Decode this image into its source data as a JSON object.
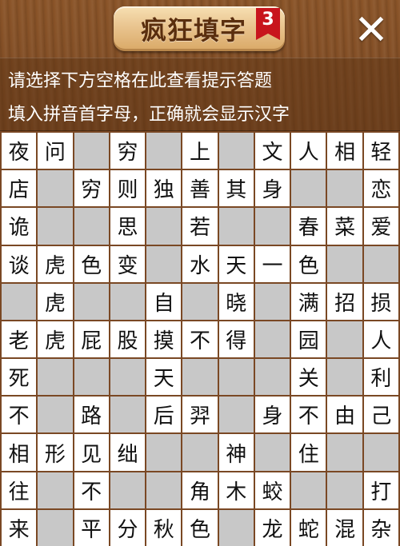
{
  "header": {
    "title": "疯狂填字",
    "level": "3",
    "close_label": "✕"
  },
  "hint": {
    "line1": "请选择下方空格在此查看提示答题",
    "line2": "填入拼音首字母，正确就会显示汉字"
  },
  "grid": {
    "cols": 11,
    "rows": [
      [
        "夜",
        "问",
        "#",
        "穷",
        "#",
        "上",
        "#",
        "文",
        "人",
        "相",
        "轻"
      ],
      [
        "店",
        "#",
        "穷",
        "则",
        "独",
        "善",
        "其",
        "身",
        "#",
        "#",
        "恋"
      ],
      [
        "诡",
        "#",
        "#",
        "思",
        "#",
        "若",
        "#",
        "#",
        "春",
        "菜",
        "爱"
      ],
      [
        "谈",
        "虎",
        "色",
        "变",
        "#",
        "水",
        "天",
        "一",
        "色",
        "#",
        "#"
      ],
      [
        "#",
        "虎",
        "#",
        "#",
        "自",
        "#",
        "晓",
        "#",
        "满",
        "招",
        "损"
      ],
      [
        "老",
        "虎",
        "屁",
        "股",
        "摸",
        "不",
        "得",
        "#",
        "园",
        "#",
        "人"
      ],
      [
        "死",
        "#",
        "#",
        "#",
        "天",
        "#",
        "#",
        "#",
        "关",
        "#",
        "利"
      ],
      [
        "不",
        "#",
        "路",
        "#",
        "后",
        "羿",
        "#",
        "身",
        "不",
        "由",
        "己"
      ],
      [
        "相",
        "形",
        "见",
        "绌",
        "#",
        "#",
        "神",
        "#",
        "住",
        "#",
        "#"
      ],
      [
        "往",
        "#",
        "不",
        "#",
        "#",
        "角",
        "木",
        "蛟",
        "#",
        "#",
        "打"
      ],
      [
        "来",
        "#",
        "平",
        "分",
        "秋",
        "色",
        "#",
        "龙",
        "蛇",
        "混",
        "杂"
      ]
    ]
  }
}
